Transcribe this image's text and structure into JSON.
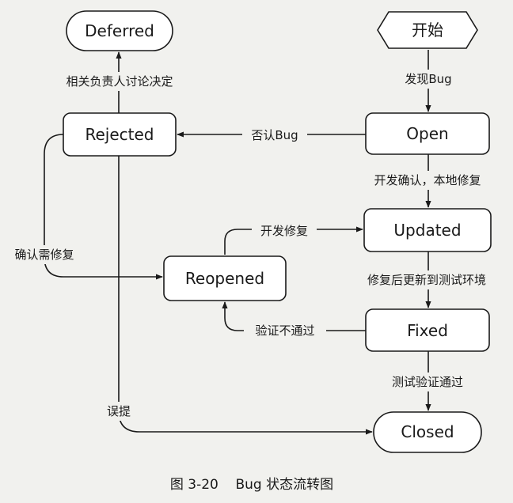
{
  "states": {
    "deferred": "Deferred",
    "start": "开始",
    "rejected": "Rejected",
    "open": "Open",
    "updated": "Updated",
    "reopened": "Reopened",
    "fixed": "Fixed",
    "closed": "Closed"
  },
  "transitions": {
    "start_open": "发现Bug",
    "open_rejected": "否认Bug",
    "rejected_deferred": "相关负责人讨论决定",
    "open_updated": "开发确认，本地修复",
    "rejected_reopened": "确认需修复",
    "reopened_updated": "开发修复",
    "updated_fixed": "修复后更新到测试环境",
    "fixed_reopened": "验证不通过",
    "fixed_closed": "测试验证通过",
    "rejected_closed": "误提"
  },
  "caption": "图 3-20    Bug 状态流转图"
}
